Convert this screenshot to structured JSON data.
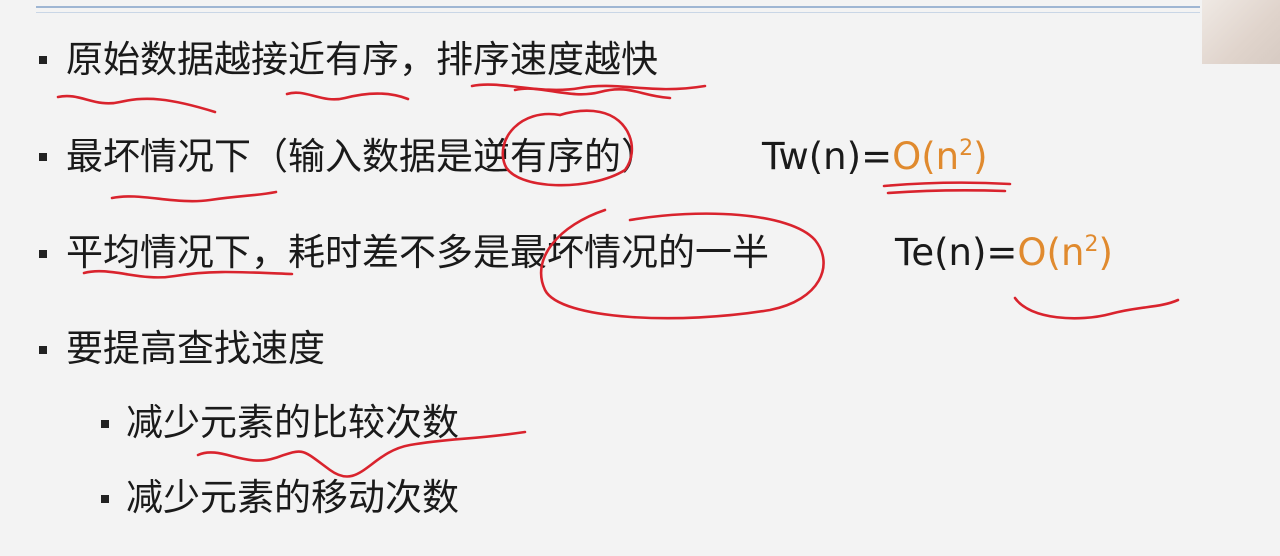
{
  "bullets": [
    {
      "text": "原始数据越接近有序，排序速度越快"
    },
    {
      "text": "最坏情况下（输入数据是逆有序的）",
      "formula": {
        "prefix": "Tw(n)",
        "eq": "=",
        "o": "O(n",
        "exp": "2",
        "close": ")"
      }
    },
    {
      "text": "平均情况下，耗时差不多是最坏情况的一半",
      "formula": {
        "prefix": "Te(n)",
        "eq": "=",
        "o": "O(n",
        "exp": "2",
        "close": ")"
      }
    },
    {
      "text": "要提高查找速度"
    }
  ],
  "sub_bullets": [
    {
      "text": "减少元素的比较次数"
    },
    {
      "text": "减少元素的移动次数"
    }
  ],
  "colors": {
    "accent": "#e08a2e",
    "ink": "#d9232d"
  }
}
